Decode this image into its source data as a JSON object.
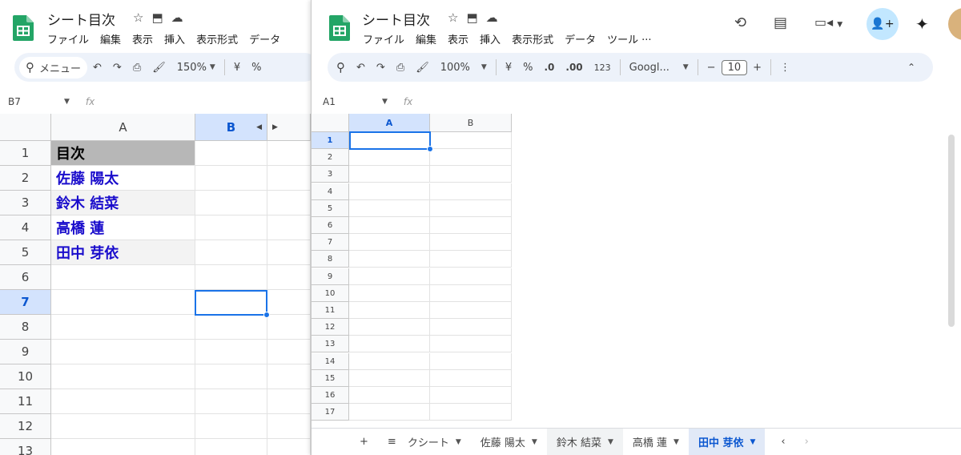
{
  "left": {
    "title": "シート目次",
    "menu": [
      "ファイル",
      "編集",
      "表示",
      "挿入",
      "表示形式",
      "データ"
    ],
    "toolbar": {
      "menu_label": "メニュー",
      "zoom": "150%",
      "currency": "¥",
      "percent": "%"
    },
    "namebox": "B7",
    "fx": "fx",
    "col_a": "A",
    "col_b": "B",
    "rows": [
      "1",
      "2",
      "3",
      "4",
      "5",
      "6",
      "7",
      "8",
      "9",
      "10",
      "11",
      "12",
      "13"
    ],
    "cells": [
      "目次",
      "佐藤 陽太",
      "鈴木 結菜",
      "高橋 蓮",
      "田中 芽依"
    ],
    "colors": {
      "link": "#1a0dcc",
      "header_bg": "#b7b7b7"
    }
  },
  "right": {
    "title": "シート目次",
    "menu": [
      "ファイル",
      "編集",
      "表示",
      "挿入",
      "表示形式",
      "データ",
      "ツール",
      "..."
    ],
    "toolbar": {
      "zoom": "100%",
      "currency": "¥",
      "percent": "%",
      "dec_minus": ".0",
      "dec_plus": ".00",
      "number": "123",
      "font": "Googl...",
      "minus": "−",
      "size": "10",
      "plus": "+"
    },
    "namebox": "A1",
    "fx": "fx",
    "col_a": "A",
    "col_b": "B",
    "rows": [
      "1",
      "2",
      "3",
      "4",
      "5",
      "6",
      "7",
      "8",
      "9",
      "10",
      "11",
      "12",
      "13",
      "14",
      "15",
      "16",
      "17"
    ],
    "tabs": [
      "クシート",
      "佐藤 陽太",
      "鈴木 結菜",
      "高橋 蓮",
      "田中 芽依"
    ]
  }
}
